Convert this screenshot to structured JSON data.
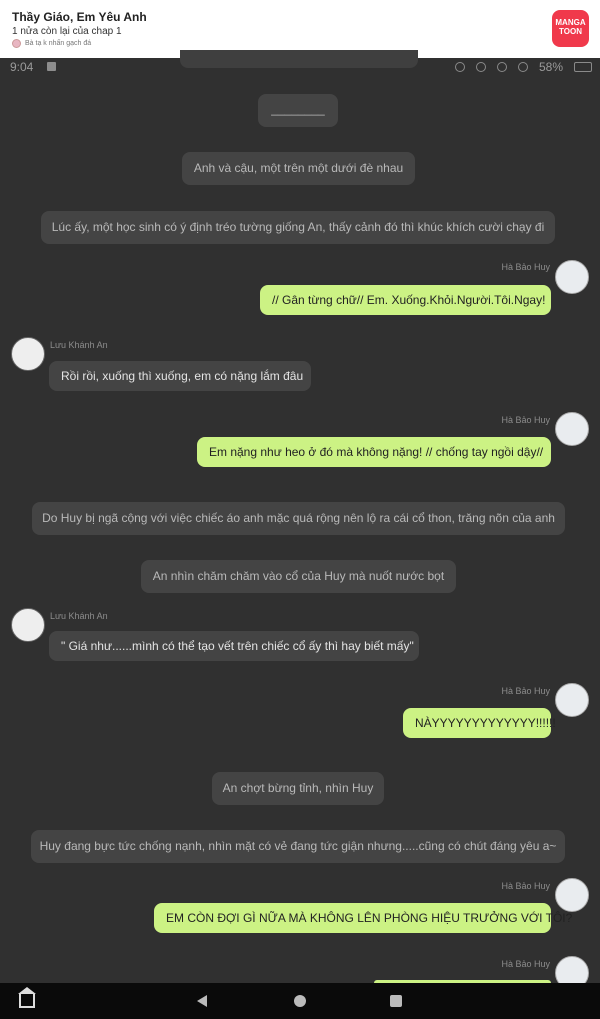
{
  "header": {
    "title": "Thầy Giáo, Em Yêu Anh",
    "subtitle": "1 nửa còn lại của chap 1",
    "note": "Bà tạ k nhấn gạch đá",
    "logo_line1": "MANGA",
    "logo_line2": "TOON"
  },
  "status_bar": {
    "time": "9:04",
    "battery": "58%"
  },
  "messages": [
    {
      "kind": "narration",
      "text": "________"
    },
    {
      "kind": "narration",
      "text": "Anh và cậu, một trên một dưới đè nhau"
    },
    {
      "kind": "narration",
      "text": "Lúc ấy, một học sinh có ý định tréo tường giống An, thấy cảnh đó thì khúc khích cười chạy đi"
    },
    {
      "kind": "right",
      "speaker": "Hà Bảo Huy",
      "text": "// Gân từng chữ// Em. Xuống.Khỏi.Người.Tôi.Ngay!"
    },
    {
      "kind": "left",
      "speaker": "Lưu Khánh An",
      "text": "Rồi rồi, xuống thì xuống, em có nặng lắm đâu"
    },
    {
      "kind": "right",
      "speaker": "Hà Bảo Huy",
      "text": "Em nặng như heo ở đó mà không nặng! // chống tay ngồi dậy//"
    },
    {
      "kind": "narration",
      "text": "Do Huy bị ngã cộng với việc chiếc áo anh mặc quá rộng nên lộ ra cái cổ thon, trăng nõn của anh"
    },
    {
      "kind": "narration",
      "text": "An nhìn chăm chăm vào cổ của Huy mà nuốt nước bọt"
    },
    {
      "kind": "left",
      "speaker": "Lưu Khánh An",
      "text": "\" Giá như......mình có thể tạo vết trên chiếc cổ ấy thì hay biết mấy\""
    },
    {
      "kind": "right",
      "speaker": "Hà Bảo Huy",
      "text": "NÀYYYYYYYYYYYYY!!!!!!"
    },
    {
      "kind": "narration",
      "text": "An chợt bừng tỉnh, nhìn Huy"
    },
    {
      "kind": "narration",
      "text": "Huy đang bực tức chống nạnh, nhìn mặt có vẻ đang tức giận nhưng.....cũng có chút đáng yêu a~"
    },
    {
      "kind": "right",
      "speaker": "Hà Bảo Huy",
      "text": "EM CÒN ĐỢI GÌ NỮA MÀ KHÔNG LÊN PHÒNG HIỆU TRƯỞNG VỚI TÔI?"
    },
    {
      "kind": "right",
      "speaker": "Hà Bảo Huy",
      "text": ""
    }
  ]
}
